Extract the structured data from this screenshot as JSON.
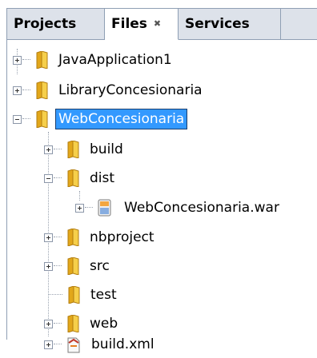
{
  "tabs": {
    "projects": "Projects",
    "files": "Files",
    "services": "Services"
  },
  "tree": {
    "java_app": "JavaApplication1",
    "library": "LibraryConcesionaria",
    "web": "WebConcesionaria",
    "build": "build",
    "dist": "dist",
    "war": "WebConcesionaria.war",
    "nbproject": "nbproject",
    "src": "src",
    "test": "test",
    "web_folder": "web",
    "build_xml": "build.xml"
  },
  "colors": {
    "selection": "#3399ff",
    "folder": "#f0c038"
  }
}
